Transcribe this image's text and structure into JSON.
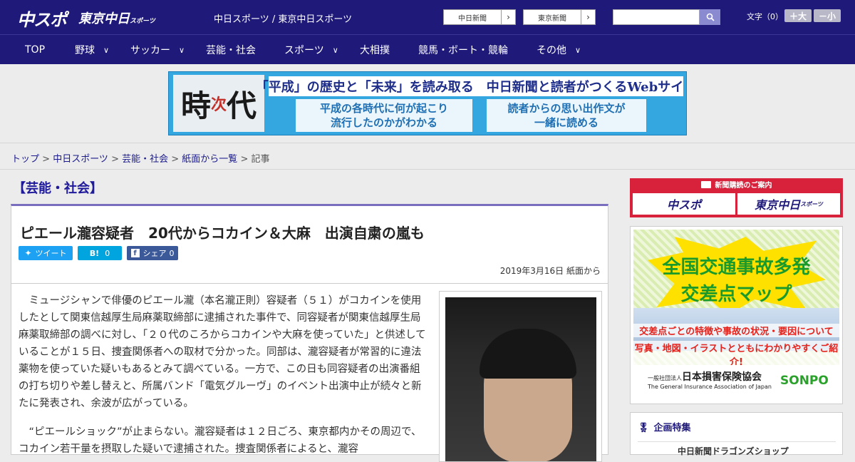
{
  "header": {
    "logo_chunichi": "中スポ",
    "logo_tokyo": "東京中日",
    "logo_tokyo_small": "スポーツ",
    "site_names": "中日スポーツ / 東京中日スポーツ",
    "btn_chunichi": "中日新聞",
    "btn_tokyo": "東京新聞",
    "search_placeholder": "",
    "fontsize_label": "文字（0）",
    "btn_bigger": "＋大",
    "btn_smaller": "－小"
  },
  "nav": {
    "items": [
      {
        "label": "TOP"
      },
      {
        "label": "野球"
      },
      {
        "label": "サッカー"
      },
      {
        "label": "芸能・社会"
      },
      {
        "label": "スポーツ"
      },
      {
        "label": "大相撲"
      },
      {
        "label": "競馬・ボート・競輪"
      },
      {
        "label": "その他"
      }
    ]
  },
  "banner": {
    "kanji": "時",
    "kanji_small": "次",
    "kanji2": "代",
    "headline": "「平成」の歴史と「未来」を読み取る　中日新聞と読者がつくるWebサイト",
    "box1": "平成の各時代に何が起こり\n流行したのかがわかる",
    "box2": "読者からの思い出作文が\n一緒に読める"
  },
  "breadcrumb": {
    "items": [
      "トップ",
      "中日スポーツ",
      "芸能・社会",
      "紙面から一覧"
    ],
    "current": "記事",
    "sep": " > "
  },
  "category": "【芸能・社会】",
  "article": {
    "title": "ピエール瀧容疑者　20代からコカイン＆大麻　出演自粛の嵐も",
    "tweet": "ツイート",
    "hatena": "B!",
    "hatena_count": "0",
    "fb_share": "シェア",
    "fb_count": "0",
    "date": "2019年3月16日 紙面から",
    "para1": "ミュージシャンで俳優のピエール瀧（本名瀧正則）容疑者（５１）がコカインを使用したとして関東信越厚生局麻薬取締部に逮捕された事件で、同容疑者が関東信越厚生局麻薬取締部の調べに対し、「２０代のころからコカインや大麻を使っていた」と供述していることが１５日、捜査関係者への取材で分かった。同部は、瀧容疑者が常習的に違法薬物を使っていた疑いもあるとみて調べている。一方で、この日も同容疑者の出演番組の打ち切りや差し替えと、所属バンド「電気グルーヴ」のイベント出演中止が続々と新たに発表され、余波が広がっている。",
    "para2": "“ピエールショック”が止まらない。瀧容疑者は１２日ごろ、東京都内かその周辺で、コカイン若干量を摂取した疑いで逮捕された。捜査関係者によると、瀧容"
  },
  "sidebar": {
    "sub_head": "新聞購読のご案内",
    "sub_logo1": "中スポ",
    "sub_logo2": "東京中日",
    "sub_logo2_small": "スポーツ",
    "ad_t1": "全国交通事故多発",
    "ad_t2": "交差点マップ",
    "ad_t3": "交差点ごとの特徴や事故の状況・要因について",
    "ad_t4": "写真・地図・イラストとともにわかりやすくご紹介!",
    "ad_assoc_prefix": "一般社団法人",
    "ad_assoc": "日本損害保険協会",
    "ad_assoc_en": "The General Insurance Association of Japan",
    "ad_sonpo": "SONPO",
    "feature_title": "企画特集",
    "feature_item": "中日新聞ドラゴンズショップ"
  },
  "colors": {
    "header_bg": "#1f1a7a",
    "accent_red": "#d8223c",
    "twitter": "#1da1f2",
    "hatena": "#00a4de",
    "facebook": "#3b5998"
  }
}
